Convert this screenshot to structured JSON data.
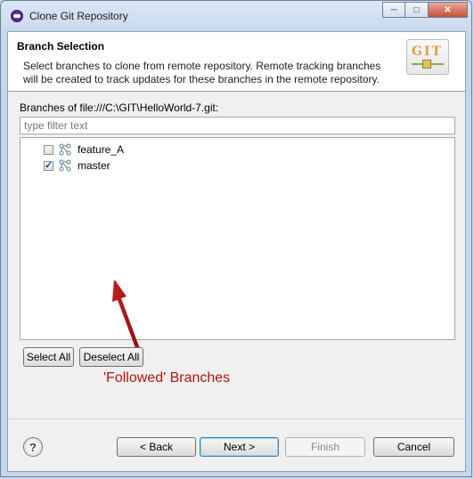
{
  "window": {
    "title": "Clone Git Repository",
    "controls": {
      "minimize": "─",
      "maximize": "□",
      "close": "✕"
    }
  },
  "header": {
    "title": "Branch Selection",
    "description": "Select branches to clone from remote repository. Remote tracking branches will be created to track updates for these branches in the remote repository.",
    "logo_text": "GIT"
  },
  "branches": {
    "label": "Branches of file:///C:\\GIT\\HelloWorld-7.git:",
    "filter_placeholder": "type filter text",
    "items": [
      {
        "label": "feature_A",
        "checked": false
      },
      {
        "label": "master",
        "checked": true
      }
    ]
  },
  "annotation": {
    "text": "'Followed' Branches",
    "color": "#b11414"
  },
  "selection_buttons": {
    "select_all": "Select All",
    "deselect_all": "Deselect All"
  },
  "footer": {
    "help": "?",
    "back": "< Back",
    "next": "Next >",
    "finish": "Finish",
    "cancel": "Cancel"
  }
}
